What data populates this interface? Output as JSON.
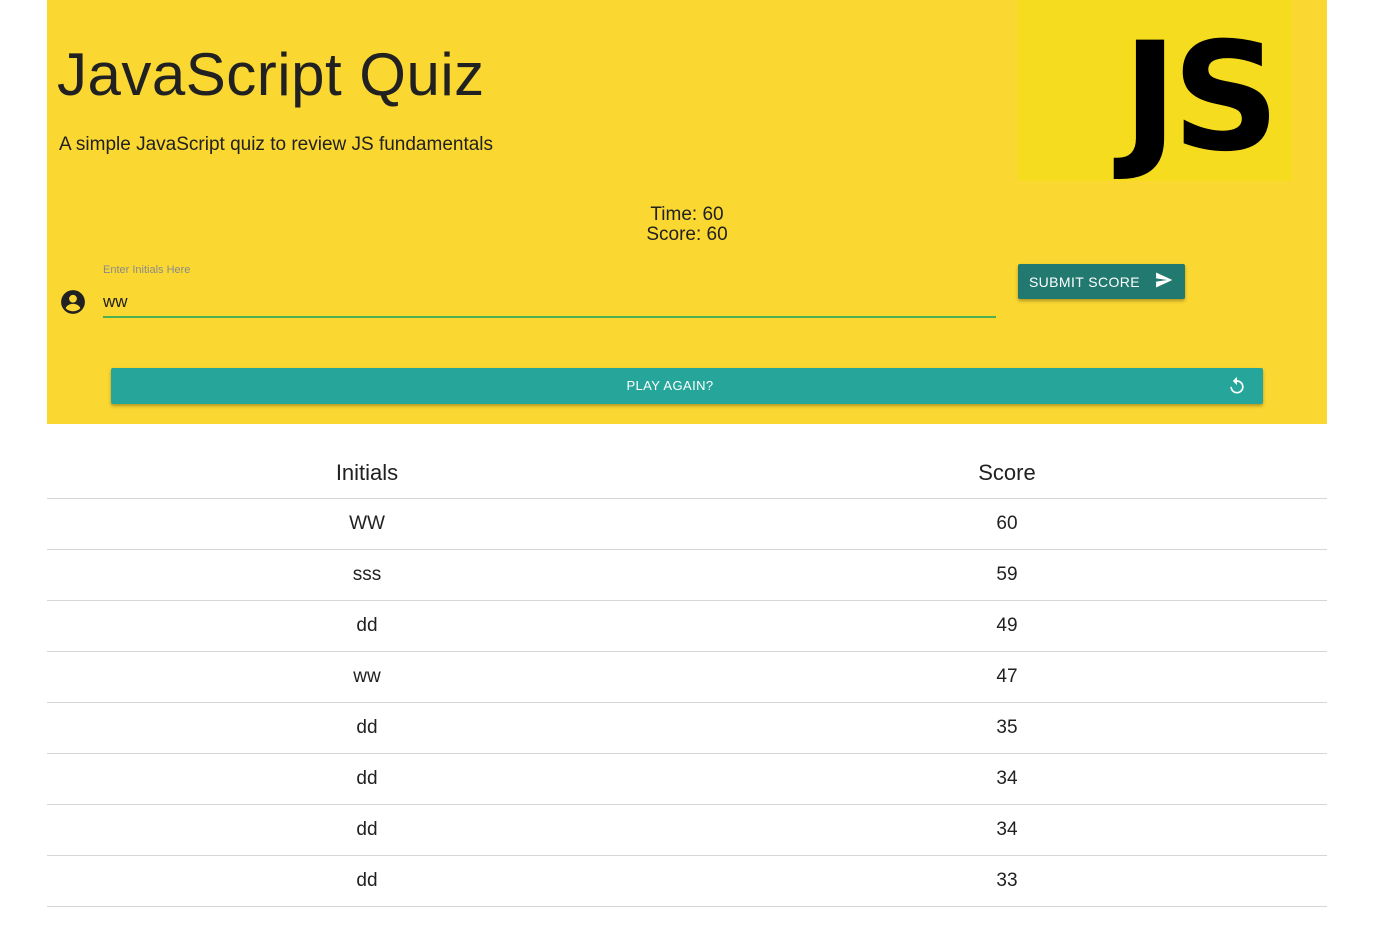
{
  "header": {
    "title": "JavaScript Quiz",
    "subtitle": "A simple JavaScript quiz to review JS fundamentals",
    "logo_text": "JS",
    "background_color": "#fbd731"
  },
  "stats": {
    "time": "Time: 60",
    "score": "Score: 60"
  },
  "form": {
    "label": "Enter Initials Here",
    "initials_value": "ww",
    "account_icon": "account-circle-icon",
    "submit_label": "SUBMIT SCORE",
    "submit_icon": "send-icon",
    "submit_color": "#21796f"
  },
  "play_again": {
    "label": "PLAY AGAIN?",
    "icon": "replay-icon",
    "color": "#26a69a"
  },
  "scoreboard": {
    "headers": [
      "Initials",
      "Score"
    ],
    "rows": [
      {
        "initials": "WW",
        "score": "60"
      },
      {
        "initials": "sss",
        "score": "59"
      },
      {
        "initials": "dd",
        "score": "49"
      },
      {
        "initials": "ww",
        "score": "47"
      },
      {
        "initials": "dd",
        "score": "35"
      },
      {
        "initials": "dd",
        "score": "34"
      },
      {
        "initials": "dd",
        "score": "34"
      },
      {
        "initials": "dd",
        "score": "33"
      }
    ]
  }
}
